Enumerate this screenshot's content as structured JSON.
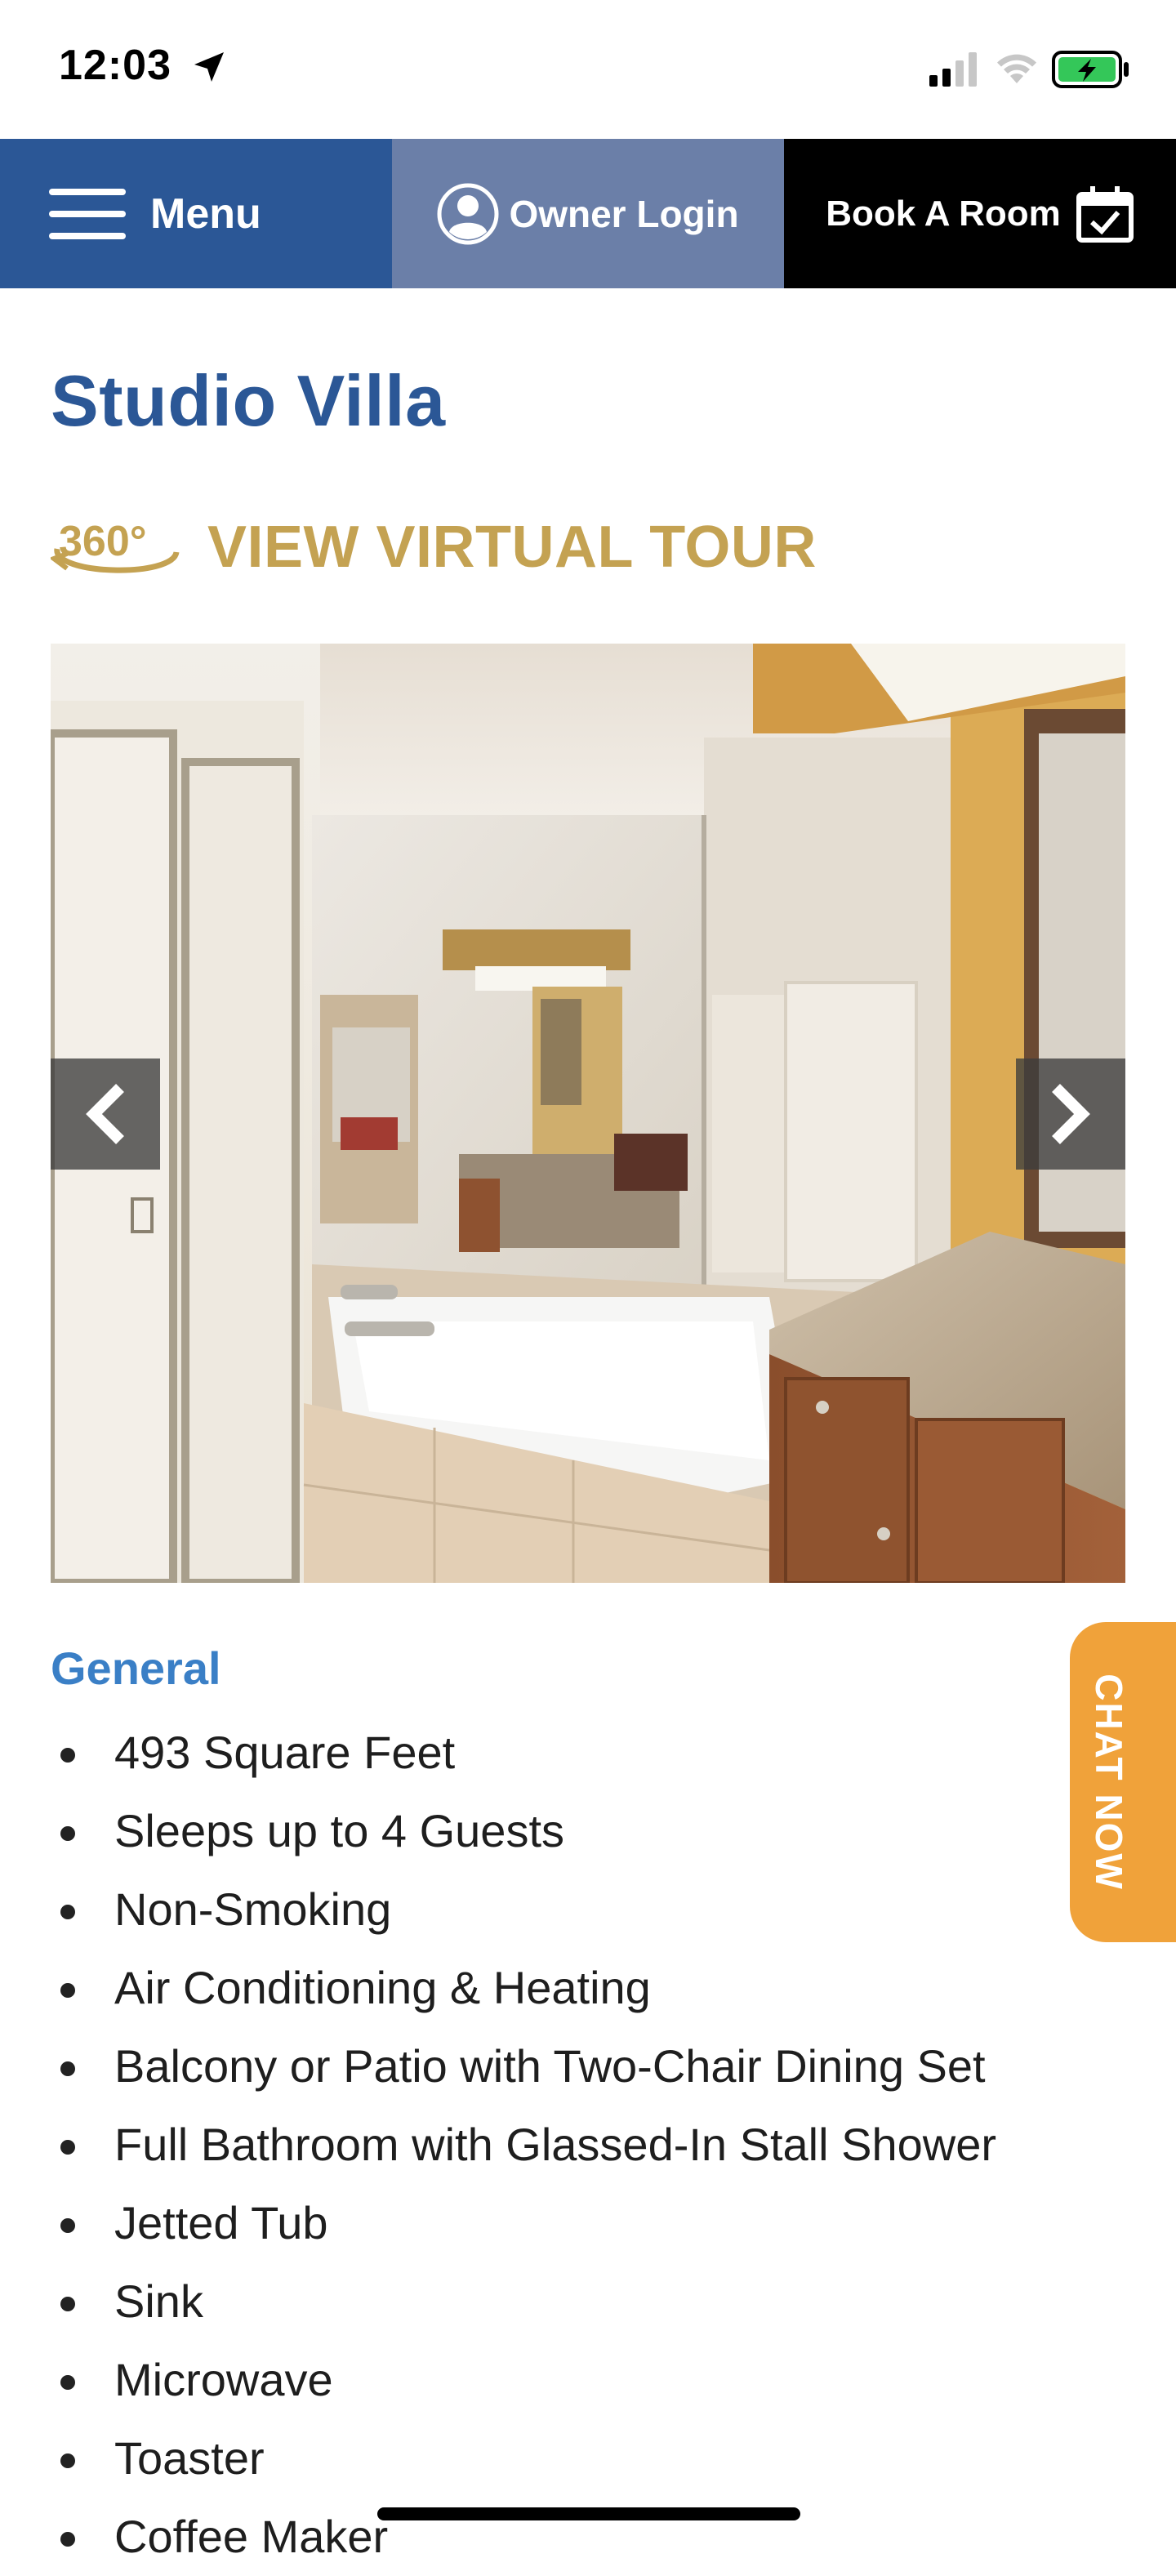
{
  "status_bar": {
    "time": "12:03",
    "location_icon": "location-arrow-icon",
    "signal_icon": "cellular-signal-icon",
    "wifi_icon": "wifi-icon",
    "battery_icon": "battery-charging-icon",
    "battery_color": "#34c759"
  },
  "nav": {
    "menu_label": "Menu",
    "owner_login_label": "Owner Login",
    "book_label": "Book A Room",
    "menu_bg": "#2b5796",
    "owner_bg": "#6b7fa8",
    "book_bg": "#000000"
  },
  "page": {
    "title": "Studio Villa",
    "tour_badge": "360°",
    "tour_label": "VIEW VIRTUAL TOUR",
    "title_color": "#2b5796",
    "tour_color": "#c4a252"
  },
  "carousel": {
    "image": "bathroom-photo",
    "prev_icon": "chevron-left-icon",
    "next_icon": "chevron-right-icon"
  },
  "details": {
    "heading": "General",
    "features": [
      "493 Square Feet",
      "Sleeps up to 4 Guests",
      "Non-Smoking",
      "Air Conditioning & Heating",
      "Balcony or Patio with Two-Chair Dining Set",
      "Full Bathroom with Glassed-In Stall Shower",
      "Jetted Tub",
      "Sink",
      "Microwave",
      "Toaster",
      "Coffee Maker"
    ]
  },
  "chat": {
    "label": "CHAT NOW",
    "color": "#f0a23a"
  }
}
